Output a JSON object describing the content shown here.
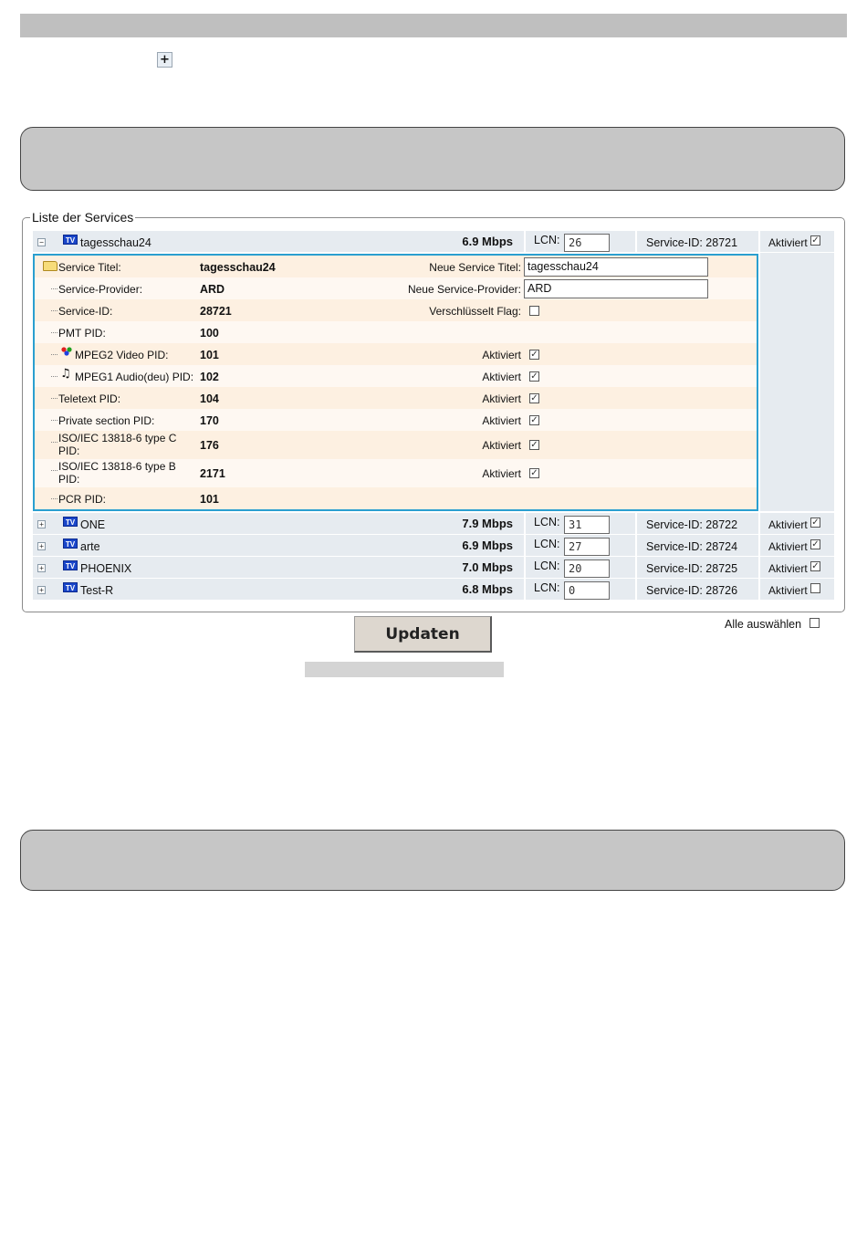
{
  "top_bar": {},
  "expand_icon": "plus-box-icon",
  "services": {
    "legend": "Liste der Services",
    "lcn_label": "LCN:",
    "aktiviert_label": "Aktiviert",
    "items": [
      {
        "name": "tagesschau24",
        "rate": "6.9 Mbps",
        "lcn": "26",
        "service_id": "Service-ID: 28721",
        "enabled": true,
        "expanded": true,
        "toggle": "−"
      },
      {
        "name": "ONE",
        "rate": "7.9 Mbps",
        "lcn": "31",
        "service_id": "Service-ID: 28722",
        "enabled": true,
        "expanded": false,
        "toggle": "+"
      },
      {
        "name": "arte",
        "rate": "6.9 Mbps",
        "lcn": "27",
        "service_id": "Service-ID: 28724",
        "enabled": true,
        "expanded": false,
        "toggle": "+"
      },
      {
        "name": "PHOENIX",
        "rate": "7.0 Mbps",
        "lcn": "20",
        "service_id": "Service-ID: 28725",
        "enabled": true,
        "expanded": false,
        "toggle": "+"
      },
      {
        "name": "Test-R",
        "rate": "6.8 Mbps",
        "lcn": "0",
        "service_id": "Service-ID: 28726",
        "enabled": false,
        "expanded": false,
        "toggle": "+"
      }
    ],
    "tv_icon_label": "TV",
    "detail": {
      "rows": [
        {
          "label": "Service Titel:",
          "value": "tagesschau24",
          "right_label": "Neue Service Titel:",
          "input": "tagesschau24"
        },
        {
          "label": "Service-Provider:",
          "value": "ARD",
          "right_label": "Neue Service-Provider:",
          "input": "ARD"
        },
        {
          "label": "Service-ID:",
          "value": "28721",
          "right_label": "Verschlüsselt Flag:",
          "checked": false
        },
        {
          "label": "PMT PID:",
          "value": "100"
        },
        {
          "label": "MPEG2 Video PID:",
          "value": "101",
          "right_label": "Aktiviert",
          "checked": true,
          "icon": "video-icon"
        },
        {
          "label": "MPEG1 Audio(deu) PID:",
          "value": "102",
          "right_label": "Aktiviert",
          "checked": true,
          "icon": "music-note-icon"
        },
        {
          "label": "Teletext PID:",
          "value": "104",
          "right_label": "Aktiviert",
          "checked": true
        },
        {
          "label": "Private section PID:",
          "value": "170",
          "right_label": "Aktiviert",
          "checked": true
        },
        {
          "label": "ISO/IEC 13818-6 type C PID:",
          "value": "176",
          "right_label": "Aktiviert",
          "checked": true
        },
        {
          "label": "ISO/IEC 13818-6 type B PID:",
          "value": "2171",
          "right_label": "Aktiviert",
          "checked": true
        },
        {
          "label": "PCR PID:",
          "value": "101"
        }
      ]
    }
  },
  "update_button": "Updaten",
  "select_all_label": "Alle auswählen",
  "select_all_checked": false,
  "colors": {
    "accent_border": "#2a9fd0",
    "row_bg": "#e6ebf0",
    "detail_odd": "#fdf0e1",
    "detail_even": "#fef8f2",
    "panel_bg": "#c6c6c6"
  }
}
